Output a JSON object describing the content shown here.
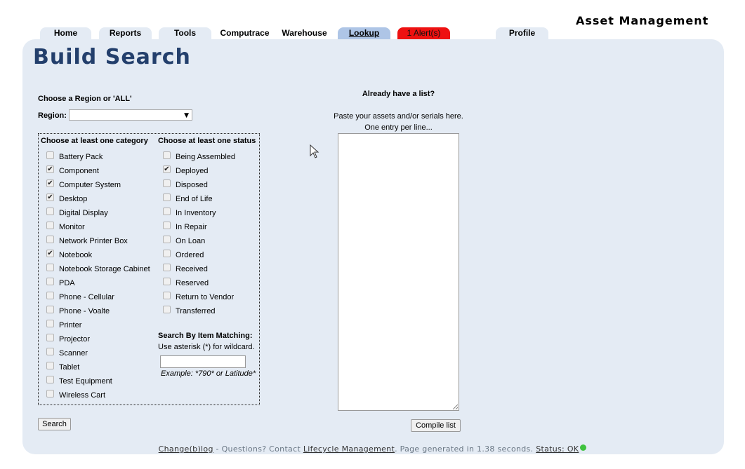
{
  "header": {
    "app_title": "Asset Management",
    "tabs": [
      {
        "label": "Home"
      },
      {
        "label": "Reports"
      },
      {
        "label": "Tools"
      },
      {
        "label": "Computrace"
      },
      {
        "label": "Warehouse"
      },
      {
        "label": "Lookup"
      },
      {
        "label": "1 Alert(s)"
      },
      {
        "label": "Profile"
      }
    ]
  },
  "page": {
    "title": "Build Search",
    "region_prompt": "Choose a Region or 'ALL'",
    "region_label": "Region:",
    "region_value": "",
    "category_heading": "Choose at least one category",
    "status_heading": "Choose at least one status",
    "categories": [
      {
        "label": "Battery Pack",
        "checked": false
      },
      {
        "label": "Component",
        "checked": true
      },
      {
        "label": "Computer System",
        "checked": true
      },
      {
        "label": "Desktop",
        "checked": true
      },
      {
        "label": "Digital Display",
        "checked": false
      },
      {
        "label": "Monitor",
        "checked": false
      },
      {
        "label": "Network Printer Box",
        "checked": false
      },
      {
        "label": "Notebook",
        "checked": true
      },
      {
        "label": "Notebook Storage Cabinet",
        "checked": false
      },
      {
        "label": "PDA",
        "checked": false
      },
      {
        "label": "Phone - Cellular",
        "checked": false
      },
      {
        "label": "Phone - Voalte",
        "checked": false
      },
      {
        "label": "Printer",
        "checked": false
      },
      {
        "label": "Projector",
        "checked": false
      },
      {
        "label": "Scanner",
        "checked": false
      },
      {
        "label": "Tablet",
        "checked": false
      },
      {
        "label": "Test Equipment",
        "checked": false
      },
      {
        "label": "Wireless Cart",
        "checked": false
      }
    ],
    "statuses": [
      {
        "label": "Being Assembled",
        "checked": false
      },
      {
        "label": "Deployed",
        "checked": true
      },
      {
        "label": "Disposed",
        "checked": false
      },
      {
        "label": "End of Life",
        "checked": false
      },
      {
        "label": "In Inventory",
        "checked": false
      },
      {
        "label": "In Repair",
        "checked": false
      },
      {
        "label": "On Loan",
        "checked": false
      },
      {
        "label": "Ordered",
        "checked": false
      },
      {
        "label": "Received",
        "checked": false
      },
      {
        "label": "Reserved",
        "checked": false
      },
      {
        "label": "Return to Vendor",
        "checked": false
      },
      {
        "label": "Transferred",
        "checked": false
      }
    ],
    "item_match": {
      "heading": "Search By Item Matching:",
      "hint": "Use asterisk (*) for wildcard.",
      "value": "",
      "example": "Example: *790* or Latitude*"
    },
    "search_button": "Search",
    "list_section": {
      "heading": "Already have a list?",
      "instructions_1": "Paste your assets and/or serials here.",
      "instructions_2": "One entry per line...",
      "value": "",
      "compile_button": "Compile list"
    }
  },
  "footer": {
    "changelog_link": "Change(b)log",
    "questions_text": " - Questions? Contact ",
    "contact_link": "Lifecycle Management",
    "generated_text": ". Page generated in 1.38 seconds. ",
    "status_link": "Status: OK"
  }
}
